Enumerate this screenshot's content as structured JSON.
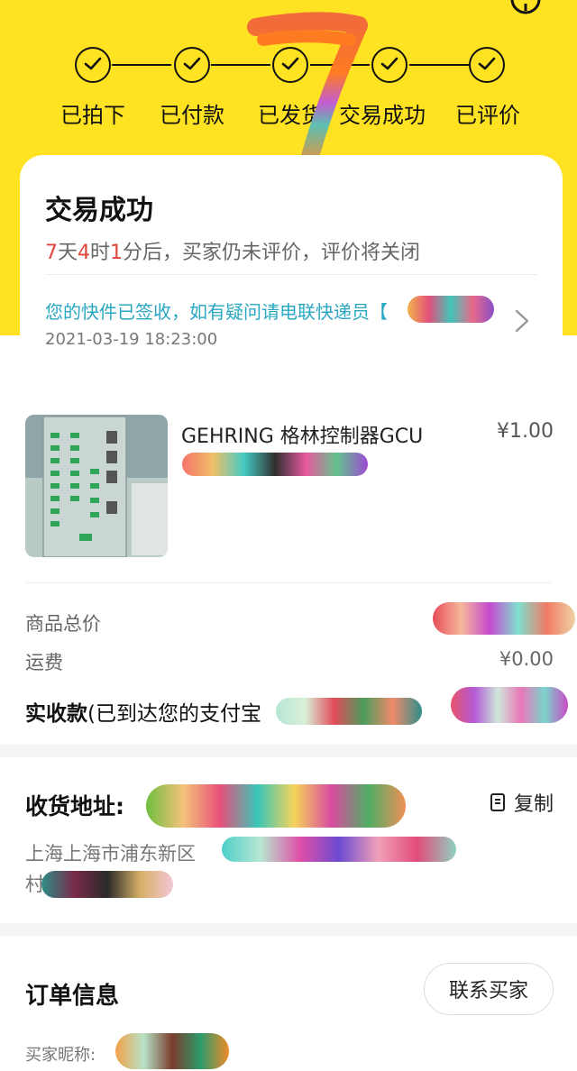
{
  "steps": [
    {
      "label": "已拍下"
    },
    {
      "label": "已付款"
    },
    {
      "label": "已发货"
    },
    {
      "label": "交易成功"
    },
    {
      "label": "已评价"
    }
  ],
  "status": {
    "title": "交易成功",
    "countdown": {
      "days": "7",
      "days_unit": "天",
      "hours": "4",
      "hours_unit": "时",
      "minutes": "1",
      "suffix": "分后，买家仍未评价，评价将关闭"
    },
    "logistics_text": "您的快件已签收，如有疑问请电联快递员【",
    "logistics_time": "2021-03-19 18:23:00"
  },
  "product": {
    "name": "GEHRING 格林控制器GCU",
    "price": "¥1.00"
  },
  "summary": {
    "total_label": "商品总价",
    "shipping_label": "运费",
    "shipping_value": "¥0.00",
    "received_label": "实收款",
    "received_note": "(已到达您的支付宝"
  },
  "address": {
    "label": "收货地址:",
    "copy_label": "复制",
    "text_line1": "上海上海市浦东新区",
    "text_line2": "村"
  },
  "order": {
    "title": "订单信息",
    "contact_button": "联系买家",
    "nickname_label": "买家昵称:"
  },
  "colors": {
    "header_yellow": "#ffe221",
    "countdown_red": "#e0453b",
    "logistics_blue": "#2aa7c3"
  }
}
